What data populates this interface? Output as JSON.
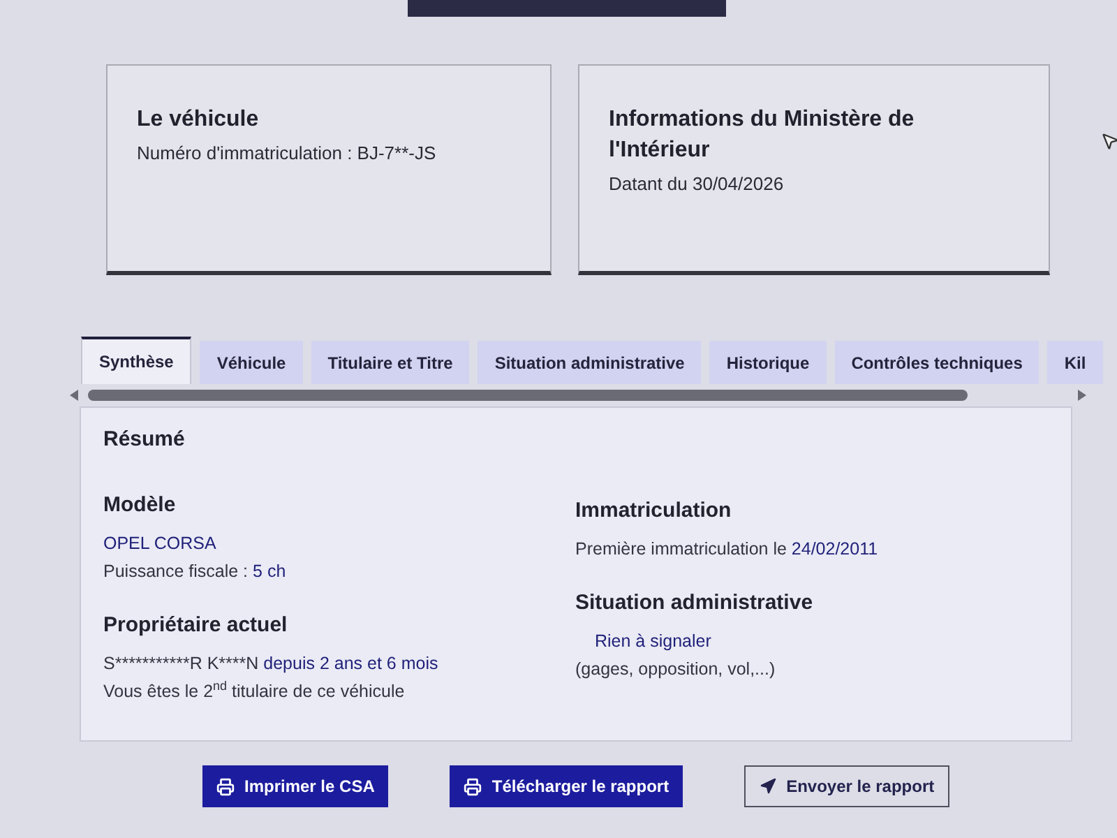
{
  "cards": [
    {
      "title": "Le véhicule",
      "lines": [
        "Numéro d'immatriculation : BJ-7**-JS"
      ]
    },
    {
      "title": "Informations du Ministère de l'Intérieur",
      "lines": [
        "Datant du 30/04/2026"
      ]
    }
  ],
  "tabs": [
    {
      "label": "Synthèse",
      "selected": true
    },
    {
      "label": "Véhicule",
      "selected": false
    },
    {
      "label": "Titulaire et Titre",
      "selected": false
    },
    {
      "label": "Situation administrative",
      "selected": false
    },
    {
      "label": "Historique",
      "selected": false
    },
    {
      "label": "Contrôles techniques",
      "selected": false
    },
    {
      "label": "Kil",
      "selected": false
    }
  ],
  "summary": {
    "title": "Résumé",
    "columns": [
      [
        {
          "heading": "Modèle",
          "lines": [
            {
              "kind": "value",
              "value": "OPEL CORSA"
            },
            {
              "kind": "pair",
              "text": "Puissance fiscale :",
              "value": "5 ch"
            }
          ]
        },
        {
          "heading": "Propriétaire actuel",
          "lines": [
            {
              "kind": "pair",
              "text": "S***********R K****N",
              "value": "depuis 2 ans et 6 mois"
            },
            {
              "kind": "text",
              "text": "Vous êtes le 2$^{nd}$ titulaire de ce véhicule"
            }
          ]
        }
      ],
      [
        {
          "heading": "Immatriculation",
          "lines": [
            {
              "kind": "pair",
              "text": "Première immatriculation le",
              "value": "24/02/2011"
            }
          ]
        },
        {
          "heading": "Situation administrative",
          "lines": [
            {
              "kind": "status",
              "value": "Rien à signaler"
            },
            {
              "kind": "text",
              "text": "(gages, opposition, vol,...)"
            }
          ]
        }
      ]
    ]
  },
  "buttons": [
    {
      "label": "Imprimer le CSA",
      "kind": "primary"
    },
    {
      "label": "Télécharger le rapport",
      "kind": "primary"
    },
    {
      "label": "Envoyer le rapport",
      "kind": "secondary"
    }
  ]
}
